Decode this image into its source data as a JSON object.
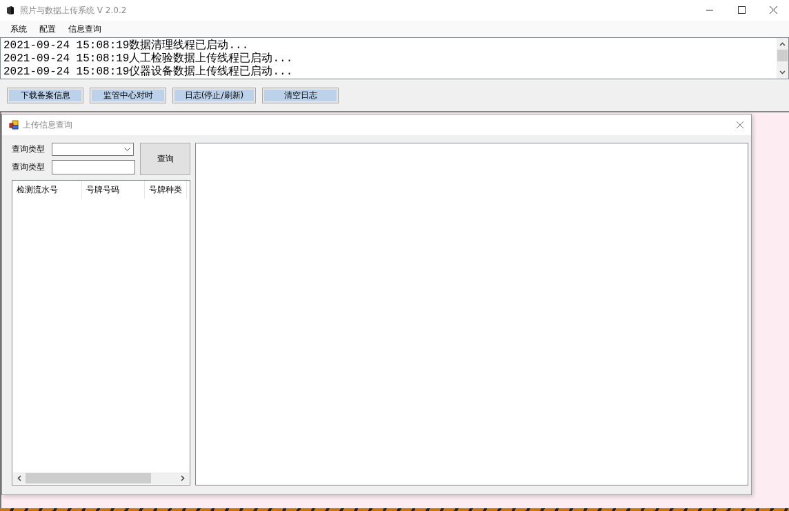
{
  "window": {
    "title": "照片与数据上传系统 V 2.0.2"
  },
  "menu": [
    "系统",
    "配置",
    "信息查询"
  ],
  "log_lines": [
    "2021-09-24 15:08:19数据清理线程已启动...",
    "2021-09-24 15:08:19人工检验数据上传线程已启动...",
    "2021-09-24 15:08:19仪器设备数据上传线程已启动..."
  ],
  "buttons": [
    "下载备案信息",
    "监管中心对时",
    "日志(停止/刷新)",
    "清空日志"
  ],
  "child_window": {
    "title": "上传信息查询",
    "fields": [
      {
        "kind": "dropdown",
        "label": "查询类型"
      },
      {
        "kind": "text",
        "label": "查询类型"
      }
    ],
    "query_button": "查询",
    "list": {
      "columns": [
        "检测流水号",
        "号牌号码",
        "号牌种类"
      ]
    }
  }
}
